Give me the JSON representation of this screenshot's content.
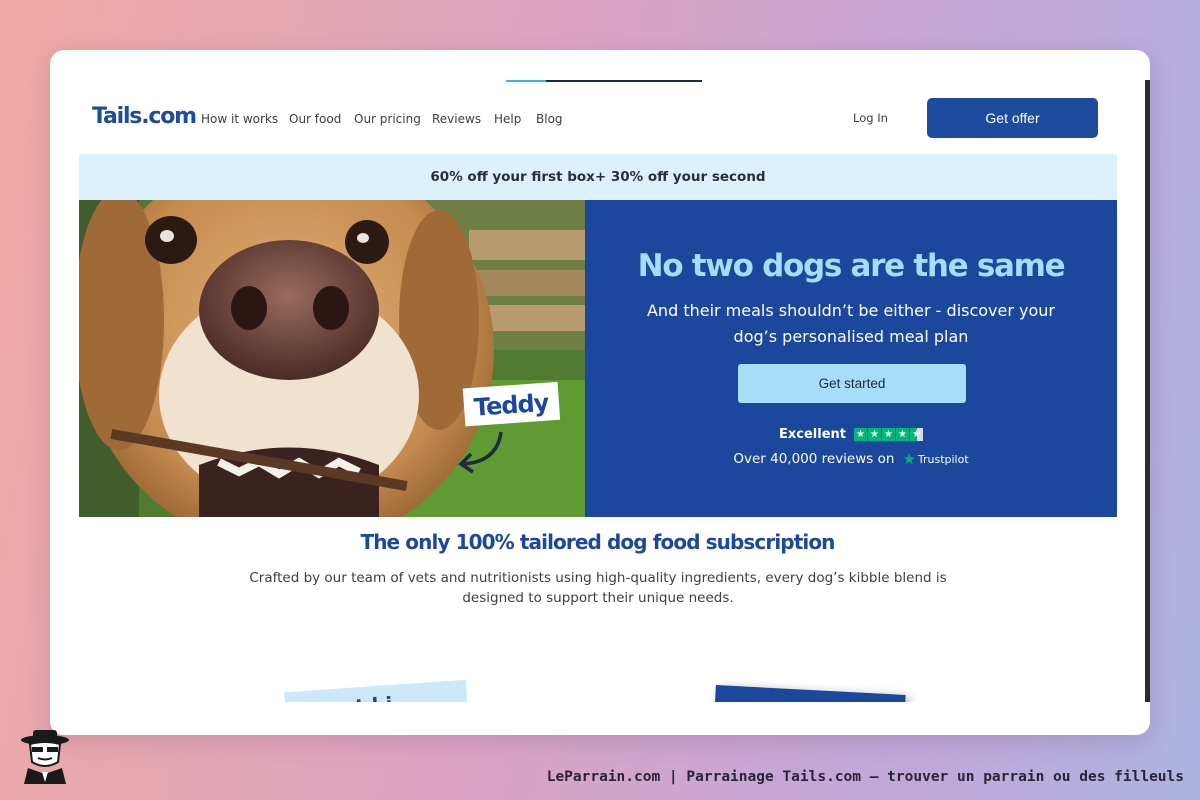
{
  "header": {
    "logo": "Tails.com",
    "nav": [
      "How it works",
      "Our food",
      "Our pricing",
      "Reviews",
      "Help",
      "Blog"
    ],
    "login_label": "Log In",
    "cta_label": "Get offer"
  },
  "promo": {
    "text": "60% off your first box+ 30% off your second"
  },
  "hero": {
    "photo_tag": "Teddy",
    "title": "No two dogs are the same",
    "subtitle": "And their meals shouldn’t be either - discover your dog’s personalised meal plan",
    "cta_label": "Get started",
    "rating_label": "Excellent",
    "stars": 4.5,
    "reviews_text": "Over 40,000 reviews on",
    "reviews_source": "Trustpilot"
  },
  "section": {
    "title": "The only 100% tailored dog food subscription",
    "description": "Crafted by our team of vets and nutritionists using high-quality ingredients, every dog’s kibble blend is designed to support their unique needs."
  },
  "footer": {
    "credit": "LeParrain.com | Parrainage Tails.com — trouver un parrain ou des filleuls"
  },
  "colors": {
    "brand_blue": "#1b479c",
    "light_blue": "#a6ddf8",
    "promo_bg": "#ddf1fd",
    "trustpilot_green": "#00b67a"
  }
}
